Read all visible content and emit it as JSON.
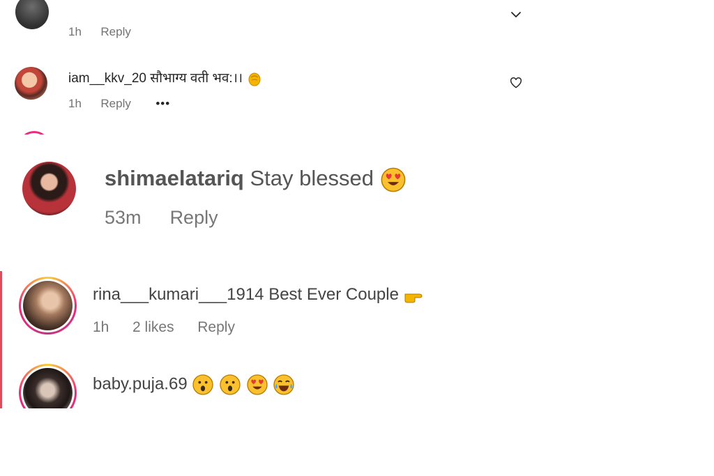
{
  "strip1": {
    "top_comment": {
      "time": "1h",
      "reply": "Reply"
    },
    "comment2": {
      "username": "iam__kkv_20",
      "text": "सौभाग्य वती भव:।।",
      "time": "1h",
      "reply": "Reply",
      "more": "•••"
    }
  },
  "strip2": {
    "username": "shimaelatariq",
    "text": "Stay blessed",
    "time": "53m",
    "reply": "Reply"
  },
  "strip3": {
    "comment1": {
      "username": "rina___kumari___1914",
      "text": "Best Ever Couple",
      "time": "1h",
      "likes": "2 likes",
      "reply": "Reply"
    },
    "comment2": {
      "username": "baby.puja.69"
    }
  },
  "icons": {
    "heart": "heart-icon",
    "chevron": "chevron-down-icon",
    "clap": "clapping-hands-emoji",
    "heart_eyes": "heart-eyes-emoji",
    "point": "pointing-hand-emoji",
    "surprised": "surprised-face-emoji",
    "laughing": "tears-of-joy-emoji"
  },
  "colors": {
    "ring_gradient_start": "#f9ce34",
    "ring_gradient_mid": "#ee2a7b",
    "meta_text": "#737373"
  }
}
